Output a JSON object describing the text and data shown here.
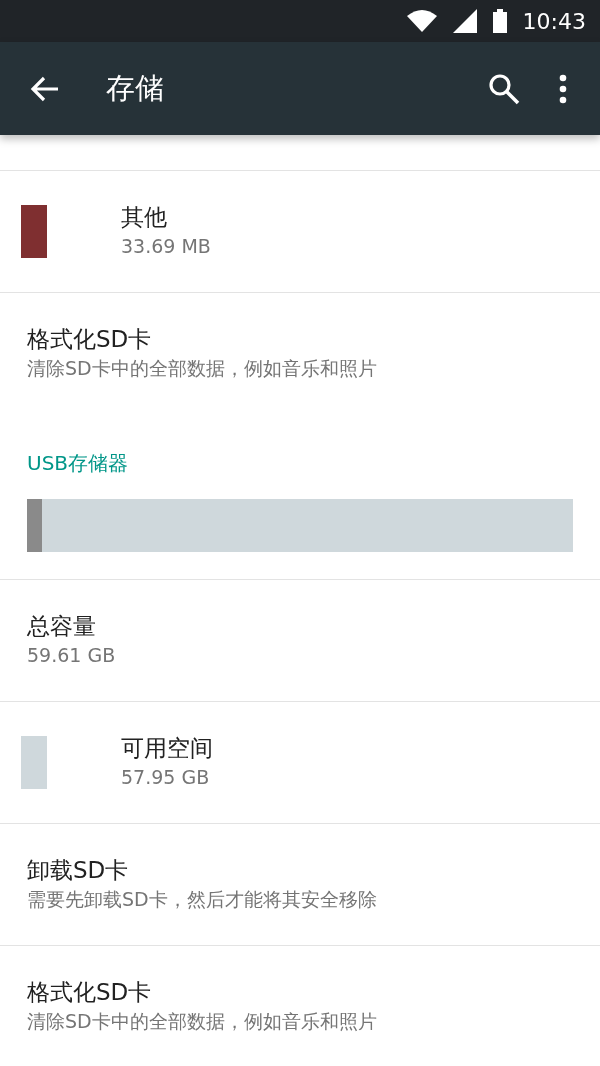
{
  "status_bar": {
    "time": "10:43"
  },
  "app_bar": {
    "title": "存储"
  },
  "items": [
    {
      "kind": "legend",
      "title": "其他",
      "subtitle": "33.69 MB",
      "color": "#7f2f30"
    },
    {
      "kind": "plain",
      "title": "格式化SD卡",
      "subtitle": "清除SD卡中的全部数据，例如音乐和照片"
    },
    {
      "kind": "header",
      "title": "USB存储器"
    },
    {
      "kind": "bar",
      "level": 0.027
    },
    {
      "kind": "plain",
      "title": "总容量",
      "subtitle": "59.61 GB"
    },
    {
      "kind": "legend",
      "title": "可用空间",
      "subtitle": "57.95 GB",
      "color": "#cfd8dc"
    },
    {
      "kind": "plain",
      "title": "卸载SD卡",
      "subtitle": "需要先卸载SD卡，然后才能将其安全移除"
    },
    {
      "kind": "plain",
      "title": "格式化SD卡",
      "subtitle": "清除SD卡中的全部数据，例如音乐和照片"
    }
  ]
}
